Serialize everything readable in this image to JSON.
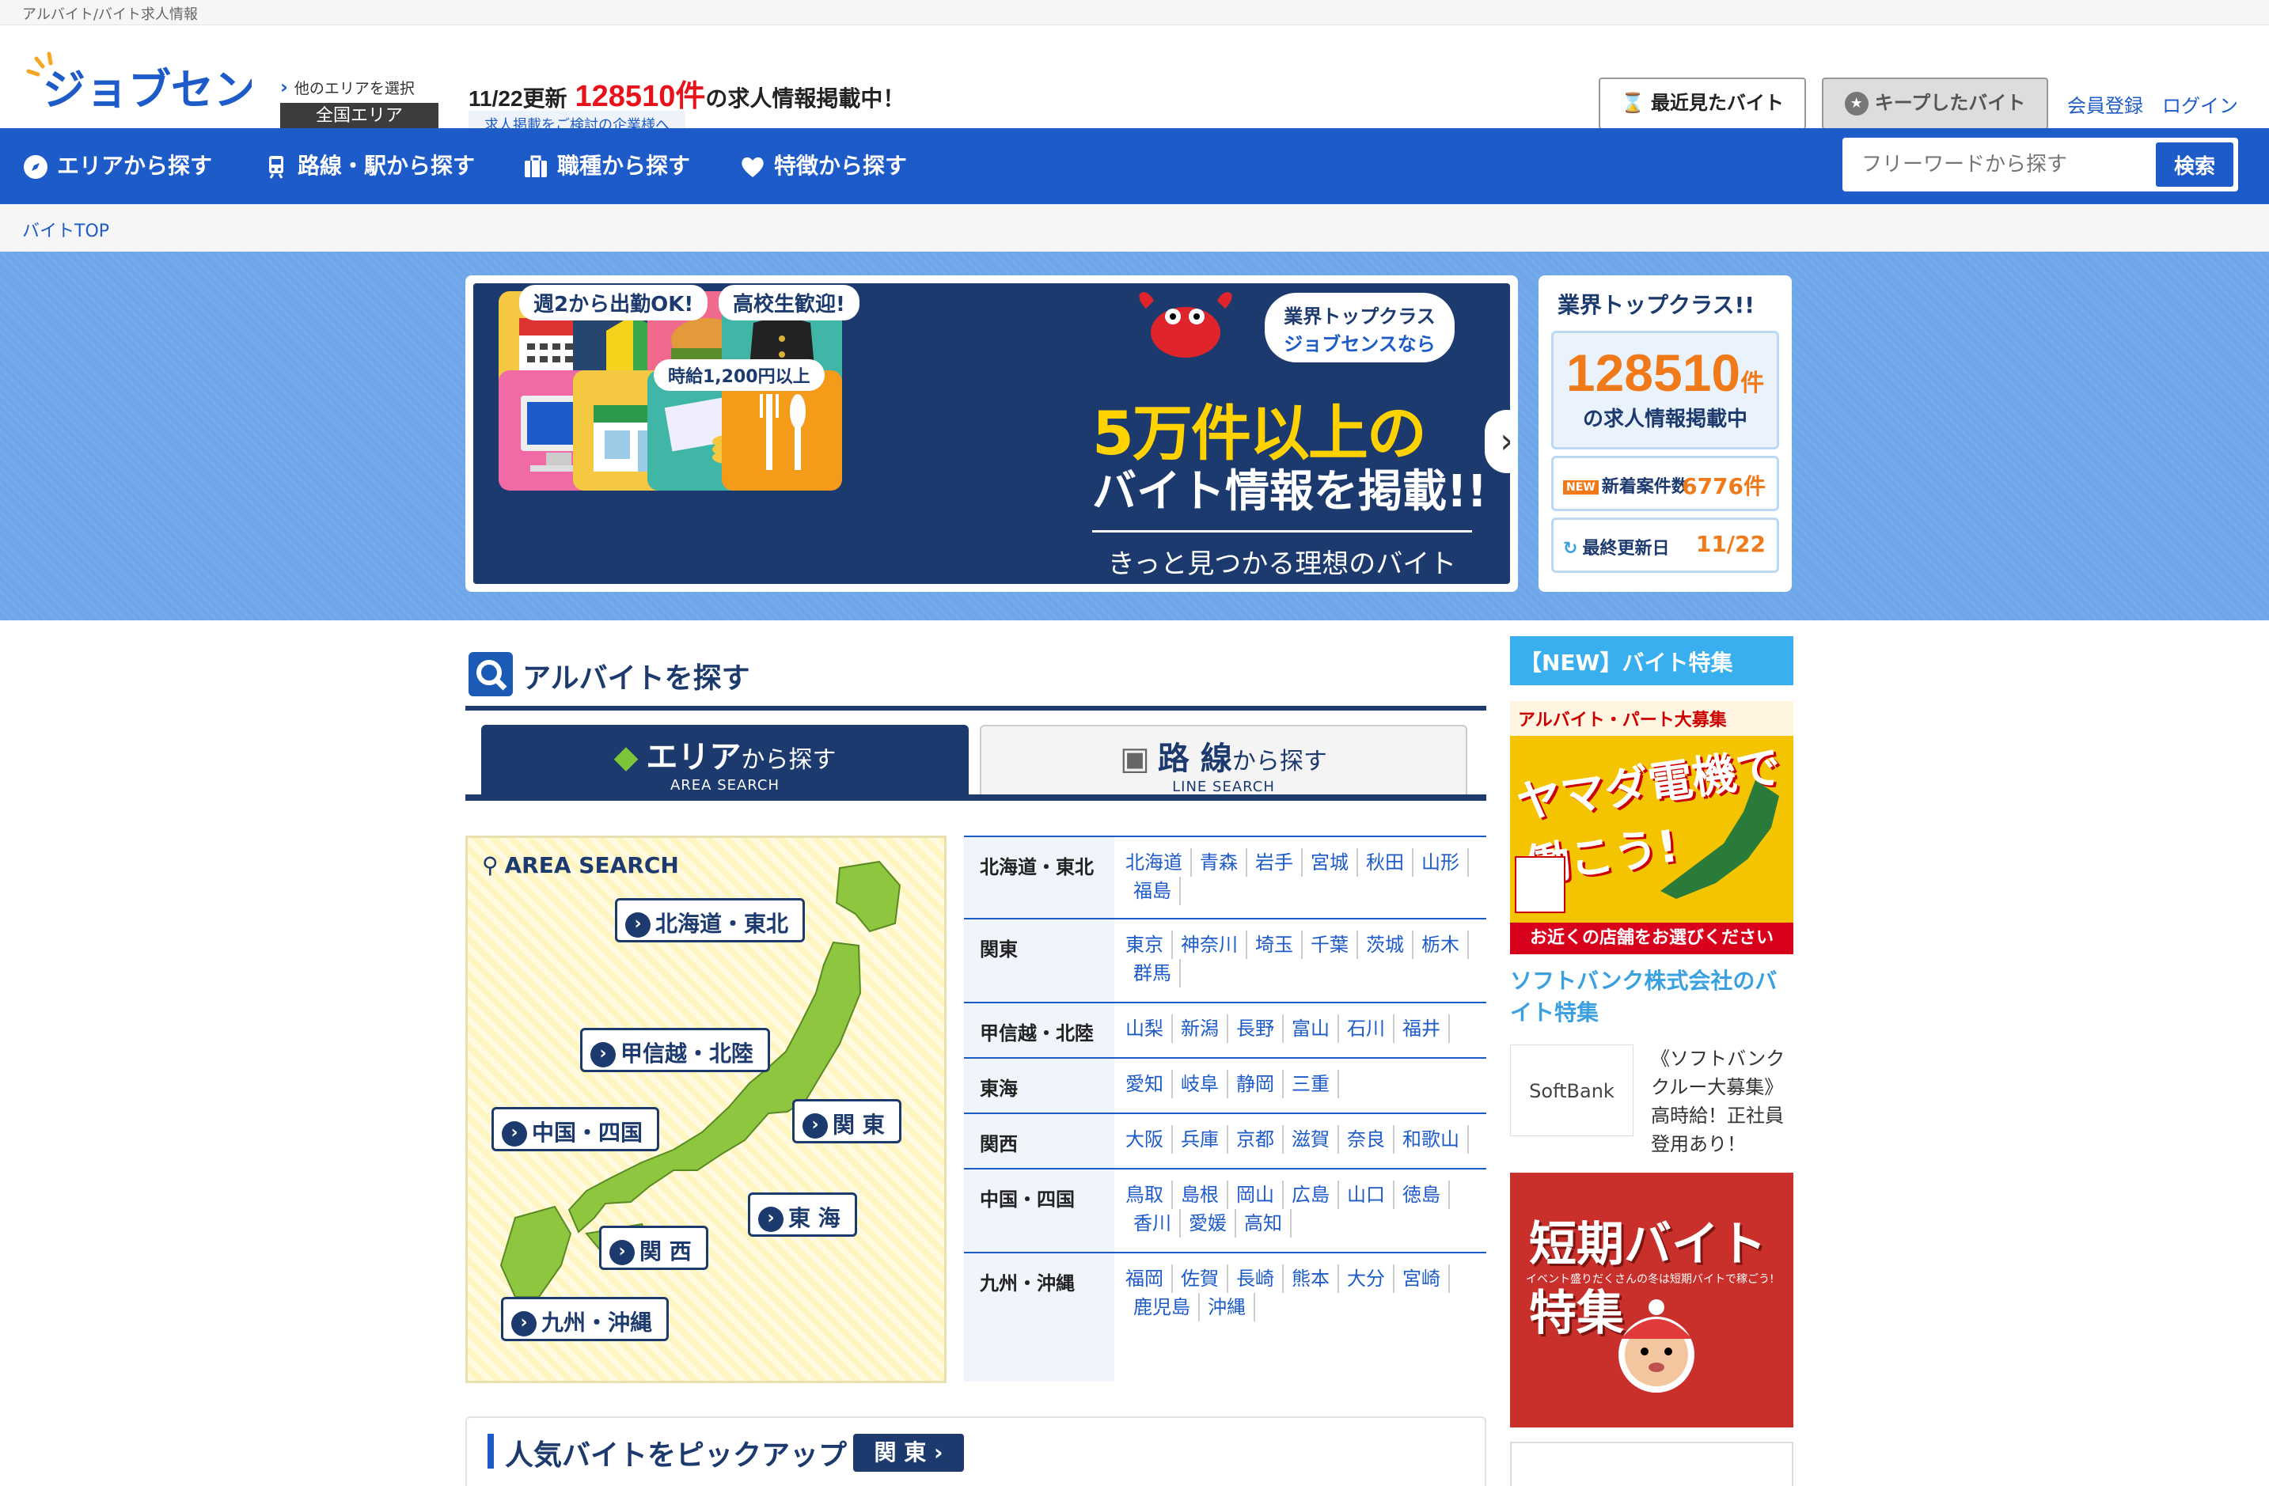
{
  "top_strip": {
    "text": "アルバイト/バイト求人情報"
  },
  "header": {
    "logo_text": "ジョブセンス",
    "area_select_label": "他のエリアを選択",
    "area_button": "全国エリア",
    "update_date": "11/22更新",
    "update_count": "128510件",
    "update_suffix": "の求人情報掲載中！",
    "recruit_link": "求人掲載をご検討の企業様へ",
    "recent_button": "最近見たバイト",
    "kept_button": "キープしたバイト",
    "register_link": "会員登録",
    "login_link": "ログイン"
  },
  "nav": {
    "items": [
      "エリアから探す",
      "路線・駅から探す",
      "職種から探す",
      "特徴から探す"
    ],
    "search_placeholder": "フリーワードから探す",
    "search_button": "検索"
  },
  "breadcrumb": {
    "home": "バイトTOP"
  },
  "banner": {
    "tag1": "週2から出勤OK!",
    "tag2": "高校生歓迎!",
    "tag3": "時給1,200円以上",
    "badge_line1": "業界トップクラス",
    "badge_line2": "ジョブセンスなら",
    "main1": "5万件以上の",
    "main2": "バイト情報を掲載!!",
    "main3": "きっと見つかる理想のバイト"
  },
  "stats": {
    "title": "業界トップクラス!!",
    "count": "128510",
    "count_unit": "件",
    "count_sub": "の求人情報掲載中",
    "new_icon": "NEW",
    "new_label": "新着案件数",
    "new_value": "6776件",
    "updated_label": "最終更新日",
    "updated_value": "11/22"
  },
  "area_section": {
    "title": "アルバイトを探す",
    "tab_area_main": "エリア",
    "tab_area_suffix": "から探す",
    "tab_area_en": "AREA SEARCH",
    "tab_line_main": "路 線",
    "tab_line_suffix": "から探す",
    "tab_line_en": "LINE SEARCH",
    "map_title": "AREA SEARCH",
    "map_buttons": [
      "北海道・東北",
      "甲信越・北陸",
      "関 東",
      "中国・四国",
      "東 海",
      "関 西",
      "九州・沖縄"
    ],
    "regions": [
      {
        "name": "北海道・東北",
        "prefs": [
          "北海道",
          "青森",
          "岩手",
          "宮城",
          "秋田",
          "山形",
          "福島"
        ]
      },
      {
        "name": "関東",
        "prefs": [
          "東京",
          "神奈川",
          "埼玉",
          "千葉",
          "茨城",
          "栃木",
          "群馬"
        ]
      },
      {
        "name": "甲信越・北陸",
        "prefs": [
          "山梨",
          "新潟",
          "長野",
          "富山",
          "石川",
          "福井"
        ]
      },
      {
        "name": "東海",
        "prefs": [
          "愛知",
          "岐阜",
          "静岡",
          "三重"
        ]
      },
      {
        "name": "関西",
        "prefs": [
          "大阪",
          "兵庫",
          "京都",
          "滋賀",
          "奈良",
          "和歌山"
        ]
      },
      {
        "name": "中国・四国",
        "prefs": [
          "鳥取",
          "島根",
          "岡山",
          "広島",
          "山口",
          "徳島",
          "香川",
          "愛媛",
          "高知"
        ]
      },
      {
        "name": "九州・沖縄",
        "prefs": [
          "福岡",
          "佐賀",
          "長崎",
          "熊本",
          "大分",
          "宮崎",
          "鹿児島",
          "沖縄"
        ]
      }
    ]
  },
  "pickup": {
    "title": "人気バイトをピックアップ",
    "region": "関 東"
  },
  "sidebar": {
    "title": "【NEW】バイト特集",
    "yamada_top": "アルバイト・パート大募集",
    "yamada_big": "ヤマダ電機で働こう!",
    "yamada_bottom": "お近くの店舗をお選びください",
    "softbank_link": "ソフトバンク株式会社のバイト特集",
    "softbank_logo": "SoftBank",
    "softbank_desc": [
      "《ソフトバンク",
      "クルー大募集》",
      "高時給！正社員",
      "登用あり！"
    ],
    "short_big": "短期バイト特集",
    "short_sub": "イベント盛りだくさんの冬は短期バイトで稼ごう!"
  },
  "colors": {
    "nav_blue": "#1d5bc9",
    "navy": "#1c3a6e",
    "accent_red": "#e8121b",
    "accent_orange": "#f07a1a",
    "hero_blue": "#6ea6e9"
  }
}
